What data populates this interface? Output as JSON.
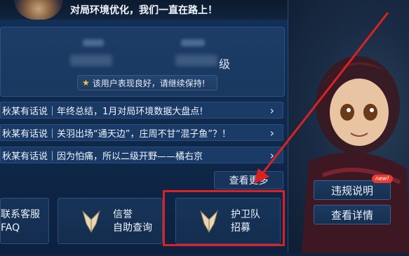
{
  "header": {
    "announcement": "对局环境优化，我们一直在路上！"
  },
  "profile": {
    "stat_suffix": "级",
    "good_badge": "该用户表现良好，请继续保持!"
  },
  "news": [
    {
      "text": "秋某有话说｜年终总结，1月对局环境数据大盘点!"
    },
    {
      "text": "秋某有话说｜关羽出场“通天边”，庄周不甘“混子鱼”？！"
    },
    {
      "text": "秋某有话说｜因为怕痛，所以二级开野——橘右京"
    }
  ],
  "more_label": "查看更多",
  "tiles": [
    {
      "line1": "联系客服",
      "line2": "FAQ"
    },
    {
      "line1": "信誉",
      "line2": "自助查询"
    },
    {
      "line1": "护卫队",
      "line2": "招募"
    }
  ],
  "side": {
    "violation_label": "违规说明",
    "details_label": "查看详情",
    "new_badge": "new!"
  },
  "colors": {
    "highlight": "#e02020",
    "star": "#f4c542",
    "badge": "#e63b2f"
  },
  "icons": [
    "chevron-right-icon",
    "star-icon",
    "horn-emblem-icon",
    "arrow-annotation"
  ]
}
